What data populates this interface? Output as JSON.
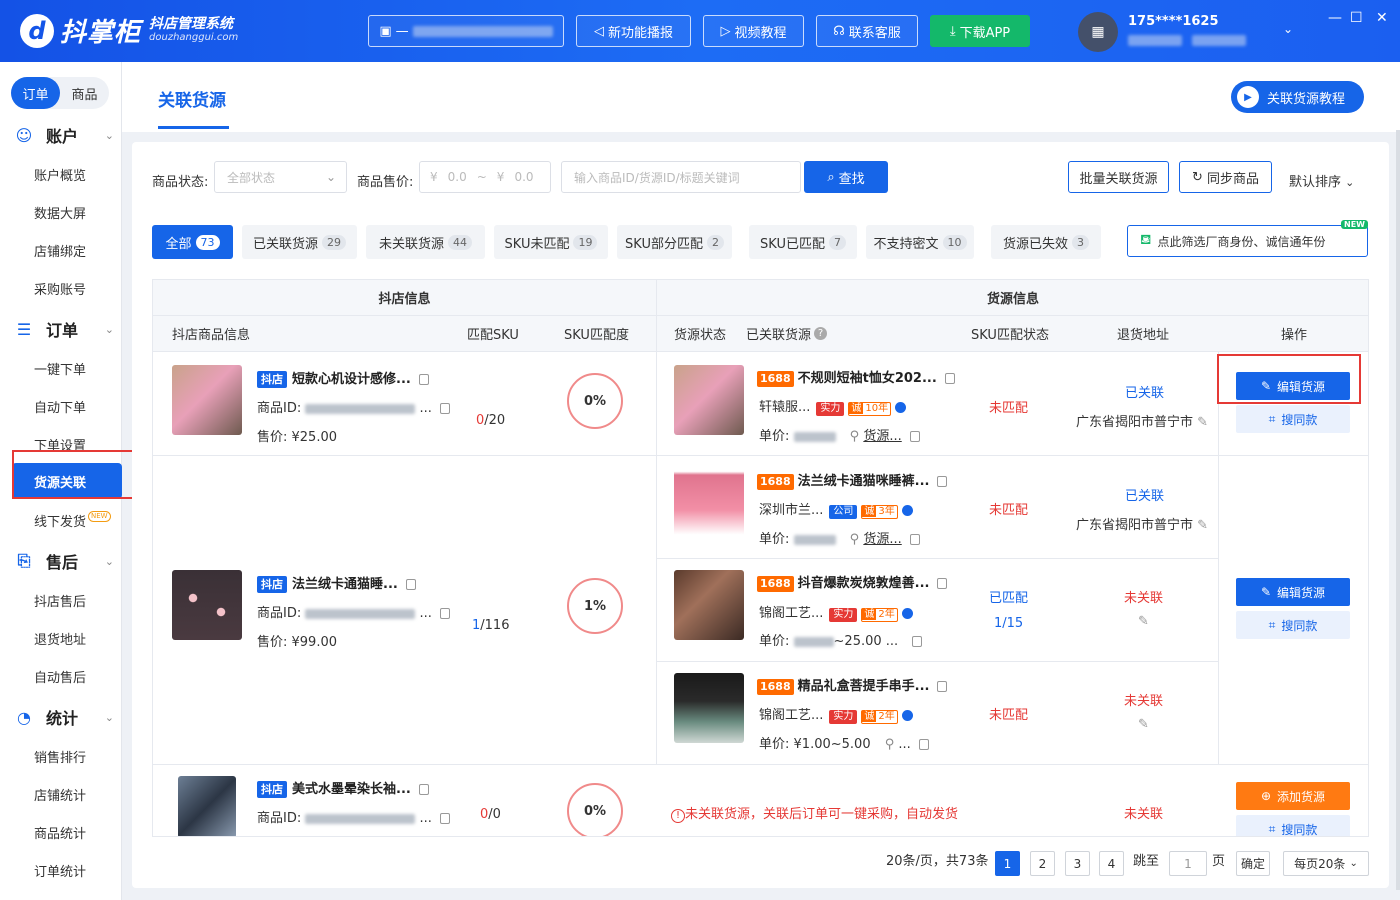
{
  "app": {
    "logo_text": "抖掌柜",
    "logo_sub1": "抖店管理系统",
    "logo_sub2": "douzhanggui.com"
  },
  "titlebar": {
    "shop_prefix": "—",
    "buttons": [
      {
        "label": "新功能播报"
      },
      {
        "label": "视频教程"
      },
      {
        "label": "联系客服"
      },
      {
        "label": "下载APP"
      }
    ],
    "user_phone": "175****1625",
    "window": {
      "minimize": "—",
      "maximize": "☐",
      "close": "✕"
    }
  },
  "sidebar": {
    "segment": [
      "订单",
      "商品"
    ],
    "sections": [
      {
        "title": "账户",
        "items": [
          "账户概览",
          "数据大屏",
          "店铺绑定",
          "采购账号"
        ]
      },
      {
        "title": "订单",
        "items": [
          "一键下单",
          "自动下单",
          "下单设置",
          "货源关联",
          "线下发货"
        ]
      },
      {
        "title": "售后",
        "items": [
          "抖店售后",
          "退货地址",
          "自动售后"
        ]
      },
      {
        "title": "统计",
        "items": [
          "销售排行",
          "店铺统计",
          "商品统计",
          "订单统计"
        ]
      }
    ],
    "new_badge": "NEW"
  },
  "page": {
    "title": "关联货源",
    "tutorial": "关联货源教程"
  },
  "filters": {
    "status_label": "商品状态:",
    "status_value": "全部状态",
    "price_label": "商品售价:",
    "price_sym": "¥",
    "price_min": "0.0",
    "price_sep": "~",
    "price_max": "0.0",
    "keyword_placeholder": "输入商品ID/货源ID/标题关键词",
    "search": "查找",
    "batch": "批量关联货源",
    "sync": "同步商品",
    "sort": "默认排序"
  },
  "tabs": [
    {
      "label": "全部",
      "count": "73"
    },
    {
      "label": "已关联货源",
      "count": "29"
    },
    {
      "label": "未关联货源",
      "count": "44"
    },
    {
      "label": "SKU未匹配",
      "count": "19"
    },
    {
      "label": "SKU部分匹配",
      "count": "2"
    },
    {
      "label": "SKU已匹配",
      "count": "7"
    },
    {
      "label": "不支持密文",
      "count": "10"
    },
    {
      "label": "货源已失效",
      "count": "3"
    }
  ],
  "factory_filter": {
    "label": "点此筛选厂商身份、诚信通年份",
    "badge": "NEW"
  },
  "table": {
    "group_left": "抖店信息",
    "group_right": "货源信息",
    "cols": [
      "抖店商品信息",
      "匹配SKU",
      "SKU匹配度",
      "货源状态",
      "已关联货源",
      "SKU匹配状态",
      "退货地址",
      "操作"
    ]
  },
  "rows": [
    {
      "tag": "抖店",
      "name": "短款心机设计感修...",
      "id_label": "商品ID:",
      "price": "售价: ¥25.00",
      "sku_a": "0",
      "sku_b": "/20",
      "match": "0%"
    },
    {
      "tag": "抖店",
      "name": "法兰绒卡通猫睡...",
      "id_label": "商品ID:",
      "price": "售价: ¥99.00",
      "sku_a": "1",
      "sku_b": "/116",
      "match": "1%"
    },
    {
      "tag": "抖店",
      "name": "美式水墨晕染长袖...",
      "id_label": "商品ID:",
      "sku_a": "0",
      "sku_b": "/0",
      "match": "0%"
    }
  ],
  "sources": [
    {
      "tag": "1688",
      "name": "不规则短袖t恤女202...",
      "seller": "轩辕服...",
      "badge": "实力",
      "cheng": "诚",
      "years": "10年",
      "unit_label": "单价:",
      "link": "货源...",
      "match_status": "未匹配",
      "link_status": "已关联",
      "address": "广东省揭阳市普宁市"
    },
    {
      "tag": "1688",
      "name": "法兰绒卡通猫咪睡裤...",
      "seller": "深圳市兰...",
      "badge": "公司",
      "cheng": "诚",
      "years": "3年",
      "unit_label": "单价:",
      "link": "货源...",
      "match_status": "未匹配",
      "link_status": "已关联",
      "address": "广东省揭阳市普宁市"
    },
    {
      "tag": "1688",
      "name": "抖音爆款炭烧敦煌善...",
      "seller": "锦阁工艺...",
      "badge": "实力",
      "cheng": "诚",
      "years": "2年",
      "unit_label": "单价:",
      "price_tail": "~25.00 ...",
      "match_status": "已匹配",
      "match_count": "1/15",
      "link_status": "未关联"
    },
    {
      "tag": "1688",
      "name": "精品礼盒菩提手串手...",
      "seller": "锦阁工艺...",
      "badge": "实力",
      "cheng": "诚",
      "years": "2年",
      "unit_label": "单价:",
      "price_full": "¥1.00~5.00",
      "link": "...",
      "match_status": "未匹配",
      "link_status": "未关联"
    }
  ],
  "unlinked_notice": "未关联货源，关联后订单可一键采购，自动发货",
  "row3_link_status": "未关联",
  "actions": {
    "edit": "编辑货源",
    "find": "搜同款",
    "add": "添加货源"
  },
  "pagination": {
    "summary": "20条/页，共73条",
    "pages": [
      "1",
      "2",
      "3",
      "4"
    ],
    "jump_label": "跳至",
    "jump_value": "1",
    "page_unit": "页",
    "confirm": "确定",
    "per_page": "每页20条"
  }
}
